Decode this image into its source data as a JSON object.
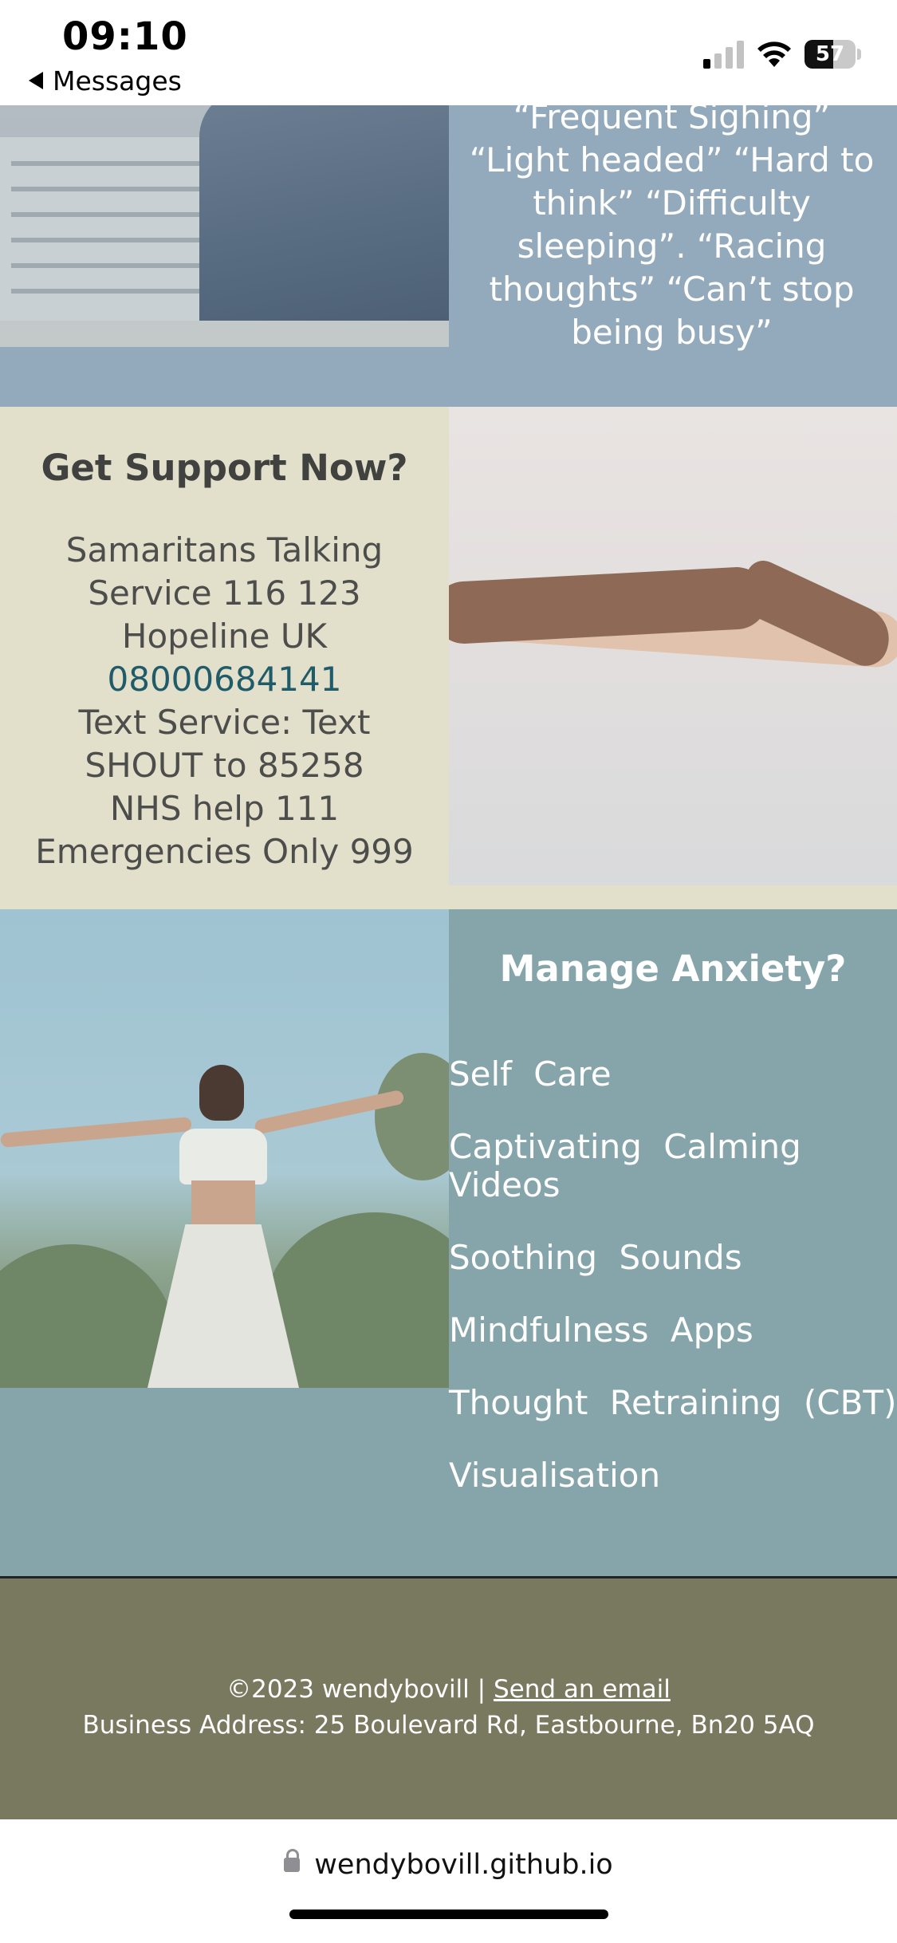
{
  "status_bar": {
    "time": "09:10",
    "back_label": "Messages",
    "battery_percent": "57",
    "battery_level": 0.57,
    "signal_bars_active": 1,
    "icons": [
      "signal-icon",
      "wifi-icon",
      "battery-icon"
    ]
  },
  "symptoms": {
    "text": "“Frequent Sighing” “Light headed” “Hard to think” “Difficulty sleeping”. “Racing thoughts” “Can’t stop being busy”"
  },
  "support": {
    "title": "Get Support Now?",
    "samaritans": "Samaritans Talking Service 116 123",
    "hopeline": "Hopeline UK",
    "hopeline_number": "08000684141",
    "text_service": "Text Service: Text SHOUT to 85258",
    "nhs": "NHS help 111",
    "emergencies": "Emergencies Only 999"
  },
  "anxiety": {
    "title": "Manage Anxiety?",
    "links": [
      {
        "label": "Self  Care"
      },
      {
        "label": "Captivating  Calming Videos"
      },
      {
        "label": "Soothing  Sounds"
      },
      {
        "label": "Mindfulness  Apps"
      },
      {
        "label": "Thought  Retraining (CBT)"
      },
      {
        "label": "Visualisation"
      }
    ]
  },
  "footer": {
    "copyright": "©2023 wendybovill |",
    "email_link": "Send an email",
    "address": "Business Address: 25 Boulevard Rd, Eastbourne, Bn20 5AQ"
  },
  "browser": {
    "url": "wendybovill.github.io"
  },
  "colors": {
    "symptoms_bg": "#93a9bc",
    "support_bg": "#e2dfcb",
    "anxiety_bg": "#86a5ab",
    "footer_bg": "#78795e",
    "link": "#1f5b69"
  }
}
